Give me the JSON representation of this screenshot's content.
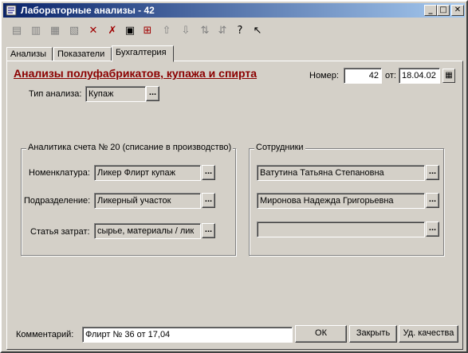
{
  "window": {
    "title": "Лабораторные анализы - 42"
  },
  "title_buttons": {
    "minimize": "_",
    "maximize": "□",
    "close": "✕"
  },
  "toolbar": {
    "icons": [
      "new-doc",
      "edit-doc",
      "copy-doc",
      "print-doc",
      "delete-doc",
      "delete-mark",
      "post",
      "unpost",
      "move-up",
      "move-down",
      "sort-asc",
      "sort-desc",
      "help",
      "whats-this"
    ]
  },
  "tabs": [
    {
      "label": "Анализы"
    },
    {
      "label": "Показатели"
    },
    {
      "label": "Бухгалтерия"
    }
  ],
  "header": {
    "title": "Анализы полуфабрикатов, купажа и спирта",
    "number_label": "Номер:",
    "number_value": "42",
    "date_label": "от:",
    "date_value": "18.04.02"
  },
  "analysis_type": {
    "label": "Тип анализа:",
    "value": "Купаж"
  },
  "analytics": {
    "title": "Аналитика счета № 20 (списание в производство)",
    "nomenclature_label": "Номенклатура:",
    "nomenclature_value": "Ликер Флирт купаж",
    "division_label": "Подразделение:",
    "division_value": "Ликерный участок",
    "cost_label": "Статья затрат:",
    "cost_value": "сырье, материалы / лик"
  },
  "employees": {
    "title": "Сотрудники",
    "list": [
      "Ватутина Татьяна Степановна",
      "Миронова Надежда Григорьевна",
      ""
    ]
  },
  "footer": {
    "comment_label": "Комментарий:",
    "comment_value": "Флирт № 36 от 17,04",
    "ok_label": "ОК",
    "close_label": "Закрыть",
    "quality_label": "Уд. качества"
  },
  "dots": "..."
}
